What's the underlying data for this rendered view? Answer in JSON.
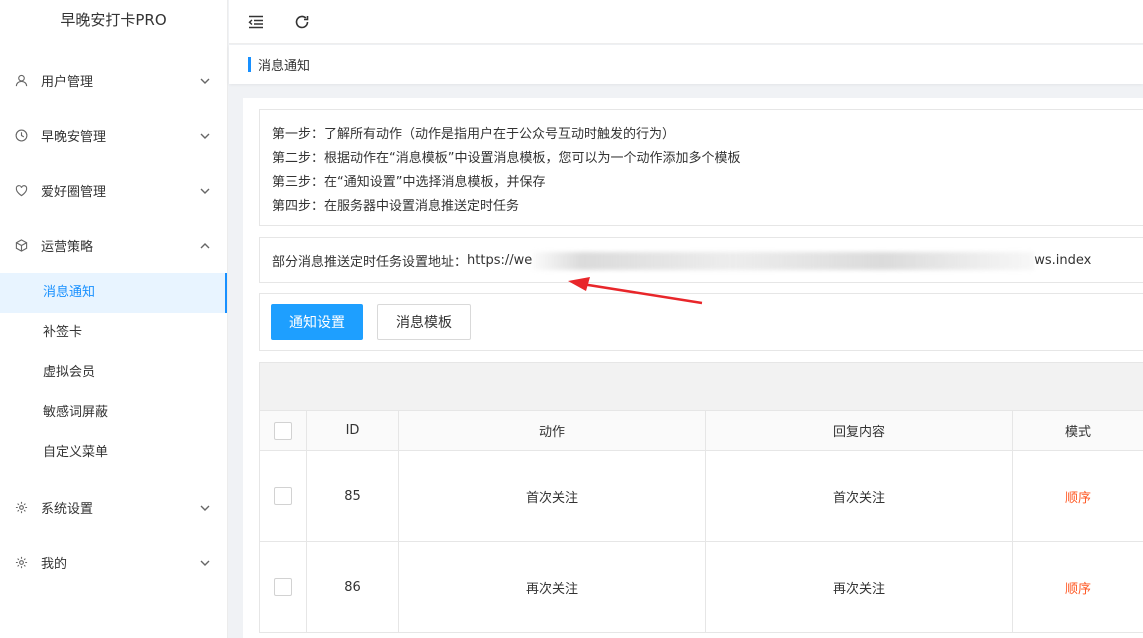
{
  "app": {
    "title": "早晚安打卡PRO"
  },
  "sidebar": {
    "items": [
      {
        "label": "用户管理",
        "icon": "user-icon"
      },
      {
        "label": "早晚安管理",
        "icon": "clock-icon"
      },
      {
        "label": "爱好圈管理",
        "icon": "heart-icon"
      },
      {
        "label": "运营策略",
        "icon": "cube-icon"
      }
    ],
    "sub_items": [
      "消息通知",
      "补签卡",
      "虚拟会员",
      "敏感词屏蔽",
      "自定义菜单"
    ],
    "bottom_items": [
      {
        "label": "系统设置",
        "icon": "gear-icon"
      },
      {
        "label": "我的",
        "icon": "gear-icon"
      }
    ]
  },
  "tabs": {
    "active": "消息通知"
  },
  "steps": [
    "第一步：了解所有动作（动作是指用户在于公众号互动时触发的行为）",
    "第二步：根据动作在“消息模板”中设置消息模板，您可以为一个动作添加多个模板",
    "第三步：在“通知设置”中选择消息模板，并保存",
    "第四步：在服务器中设置消息推送定时任务"
  ],
  "url": {
    "label": "部分消息推送定时任务设置地址：",
    "prefix": "https://we",
    "suffix": "ws.index"
  },
  "buttons": {
    "notify_settings": "通知设置",
    "message_template": "消息模板"
  },
  "table": {
    "headers": [
      "ID",
      "动作",
      "回复内容",
      "模式"
    ],
    "rows": [
      {
        "id": "85",
        "action": "首次关注",
        "reply": "首次关注",
        "mode": "顺序"
      },
      {
        "id": "86",
        "action": "再次关注",
        "reply": "再次关注",
        "mode": "顺序"
      }
    ]
  },
  "colors": {
    "accent": "#1890ff",
    "primary_button": "#1e9fff",
    "mode_text": "#ff5722",
    "arrow": "#e8262a"
  }
}
